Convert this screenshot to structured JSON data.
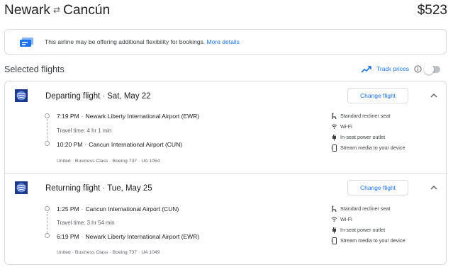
{
  "header": {
    "origin": "Newark",
    "destination": "Cancún",
    "price": "$523"
  },
  "notice": {
    "text": "This airline may be offering additional flexibility for bookings.",
    "link": "More details"
  },
  "selected_flights": {
    "title": "Selected flights",
    "track_prices_label": "Track prices",
    "track_prices_on": false
  },
  "flights": [
    {
      "direction": "Departing flight",
      "date": "Sat, May 22",
      "change_label": "Change flight",
      "depart_time": "7:19 PM",
      "depart_airport": "Newark Liberty International Airport (EWR)",
      "travel_time": "Travel time: 4 hr 1 min",
      "arrive_time": "10:20 PM",
      "arrive_airport": "Cancun International Airport (CUN)",
      "details": {
        "airline": "United",
        "cabin": "Business Class",
        "aircraft": "Boeing 737",
        "flight_number": "UA 1054"
      },
      "amenities": [
        {
          "icon": "seat-icon",
          "label": "Standard recliner seat"
        },
        {
          "icon": "wifi-icon",
          "label": "Wi-Fi"
        },
        {
          "icon": "power-plug-icon",
          "label": "In-seat power outlet"
        },
        {
          "icon": "media-device-icon",
          "label": "Stream media to your device"
        }
      ]
    },
    {
      "direction": "Returning flight",
      "date": "Tue, May 25",
      "change_label": "Change flight",
      "depart_time": "1:25 PM",
      "depart_airport": "Cancun International Airport (CUN)",
      "travel_time": "Travel time: 3 hr 54 min",
      "arrive_time": "6:19 PM",
      "arrive_airport": "Newark Liberty International Airport (EWR)",
      "details": {
        "airline": "United",
        "cabin": "Business Class",
        "aircraft": "Boeing 737",
        "flight_number": "UA 1049"
      },
      "amenities": [
        {
          "icon": "seat-icon",
          "label": "Standard recliner seat"
        },
        {
          "icon": "wifi-icon",
          "label": "Wi-Fi"
        },
        {
          "icon": "power-plug-icon",
          "label": "In-seat power outlet"
        },
        {
          "icon": "media-device-icon",
          "label": "Stream media to your device"
        }
      ]
    }
  ],
  "colors": {
    "link": "#1a73e8",
    "text": "#202124",
    "secondary_text": "#5f6368",
    "border": "#dadce0",
    "airline_logo": "#1d3a8a"
  }
}
